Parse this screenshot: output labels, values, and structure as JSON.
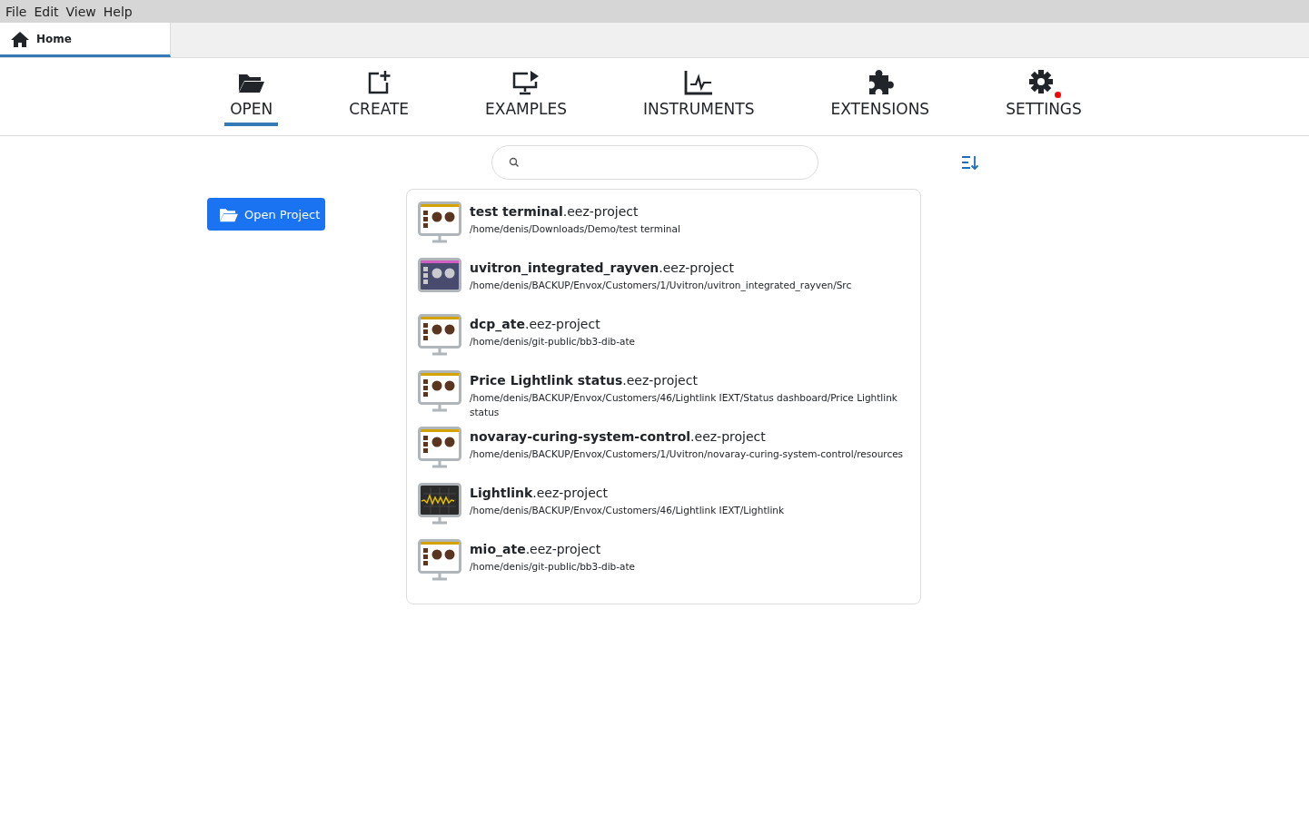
{
  "menu_bar": {
    "items": [
      "File",
      "Edit",
      "View",
      "Help"
    ]
  },
  "tabs": [
    {
      "label": "Home",
      "selected": true
    }
  ],
  "nav": [
    {
      "label": "OPEN",
      "selected": true
    },
    {
      "label": "CREATE",
      "selected": false
    },
    {
      "label": "EXAMPLES",
      "selected": false
    },
    {
      "label": "INSTRUMENTS",
      "selected": false
    },
    {
      "label": "EXTENSIONS",
      "selected": false
    },
    {
      "label": "SETTINGS",
      "selected": false,
      "notification": true
    }
  ],
  "open_project_button": "Open Project",
  "projects": [
    {
      "title": "**test terminal**.eez-project",
      "path": "/home/denis/Downloads/Demo/test terminal",
      "kind": "dashboard"
    },
    {
      "title": "**uvitron_integrated_rayven**.eez-project",
      "path": "/home/denis/BACKUP/Envox/Customers/1/Uvitron/uvitron_integrated_rayven/Src",
      "kind": "dashboard-dark"
    },
    {
      "title": "**dcp_ate**.eez-project",
      "path": "/home/denis/git-public/bb3-dib-ate",
      "kind": "dashboard"
    },
    {
      "title": "**Price Lightlink status**.eez-project",
      "path": "/home/denis/BACKUP/Envox/Customers/46/Lightlink IEXT/Status dashboard/Price Lightlink status",
      "kind": "dashboard"
    },
    {
      "title": "**novaray-curing-system-control**.eez-project",
      "path": "/home/denis/BACKUP/Envox/Customers/1/Uvitron/novaray-curing-system-control/resources",
      "kind": "dashboard"
    },
    {
      "title": "**Lightlink**.eez-project",
      "path": "/home/denis/BACKUP/Envox/Customers/46/Lightlink IEXT/Lightlink",
      "kind": "oscilloscope"
    },
    {
      "title": "**mio_ate**.eez-project",
      "path": "/home/denis/git-public/bb3-dib-ate",
      "kind": "dashboard"
    }
  ]
}
